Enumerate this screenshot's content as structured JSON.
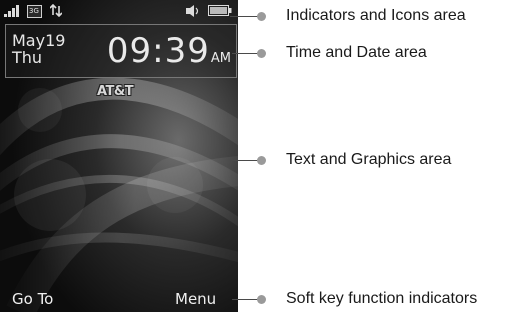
{
  "phone": {
    "date": {
      "month_day": "May19",
      "weekday": "Thu"
    },
    "time": {
      "clock": "09:39",
      "ampm": "AM"
    },
    "carrier": "AT&T",
    "softkeys": {
      "left": "Go To",
      "right": "Menu"
    },
    "status_icons": [
      "signal-strength-icon",
      "3g-icon",
      "data-transfer-icon",
      "sound-icon",
      "battery-icon"
    ],
    "status_text": {
      "network": "3G"
    }
  },
  "callouts": {
    "indicators": "Indicators and Icons area",
    "time_date": "Time and Date area",
    "text_graphics": "Text and Graphics area",
    "softkeys": "Soft key function indicators"
  }
}
